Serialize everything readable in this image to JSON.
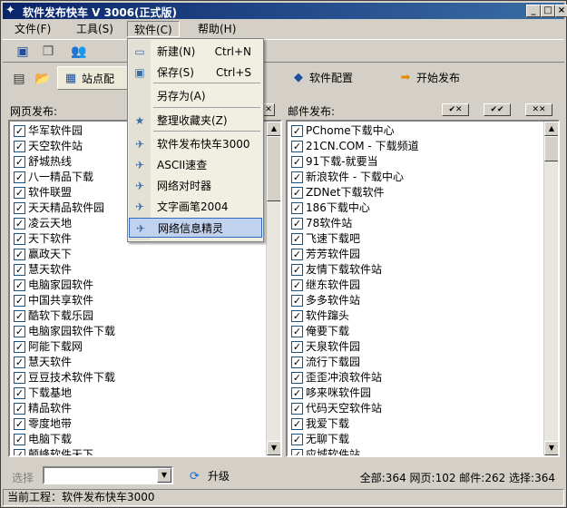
{
  "window": {
    "title": "软件发布快车 V 3006(正式版)",
    "controls": {
      "minimize": "_",
      "maximize": "□",
      "close": "×"
    }
  },
  "menubar": [
    "文件(F)",
    "工具(S)",
    "软件(C)",
    "帮助(H)"
  ],
  "toolbar2": {
    "site_config": "站点配",
    "software_config": "软件配置",
    "start_publish": "开始发布"
  },
  "left_panel": {
    "label": "网页发布:",
    "items": [
      "华军软件园",
      "天空软件站",
      "舒城热线",
      "八一精品下载",
      "软件联盟",
      "天天精品软件园",
      "凌云天地",
      "天下软件",
      "赢政天下",
      "慧天软件",
      "电脑家园软件",
      "中国共享软件",
      "酷软下载乐园",
      "电脑家园软件下载",
      "阿能下载网",
      "慧天软件",
      "豆豆技术软件下载",
      "下载基地",
      "精品软件",
      "零度地带",
      "电脑下载",
      "颠峰软件天下"
    ]
  },
  "right_panel": {
    "label": "邮件发布:",
    "buttons": [
      "✔✕",
      "✔✔",
      "✕✕"
    ],
    "items": [
      "PChome下载中心",
      "21CN.COM - 下载频道",
      "91下载-就要当",
      "新浪软件 - 下载中心",
      "ZDNet下载软件",
      "186下载中心",
      "78软件站",
      "飞速下载吧",
      "芳芳软件园",
      "友情下载软件站",
      "继东软件园",
      "多多软件站",
      "软件蹿头",
      "俺要下载",
      "天泉软件园",
      "流行下载园",
      "歪歪冲浪软件站",
      "哆来咪软件园",
      "代码天空软件站",
      "我爱下载",
      "无聊下载",
      "应城软件站"
    ]
  },
  "bottom": {
    "select_label": "选择",
    "upgrade": "升级",
    "stats": "全部:364 网页:102 邮件:262 选择:364"
  },
  "statusbar": "当前工程：软件发布快车3000",
  "dropdown": {
    "items": [
      {
        "label": "新建(N)",
        "shortcut": "Ctrl+N",
        "icon": "new-file-icon"
      },
      {
        "label": "保存(S)",
        "shortcut": "Ctrl+S",
        "icon": "save-icon"
      },
      {
        "label": "另存为(A)",
        "shortcut": "",
        "icon": ""
      },
      {
        "label": "整理收藏夹(Z)",
        "shortcut": "",
        "icon": "favorites-icon"
      },
      {
        "label": "软件发布快车3000",
        "shortcut": "",
        "icon": "project-icon"
      },
      {
        "label": "ASCII速查",
        "shortcut": "",
        "icon": "project-icon"
      },
      {
        "label": "网络对时器",
        "shortcut": "",
        "icon": "project-icon"
      },
      {
        "label": "文字画笔2004",
        "shortcut": "",
        "icon": "project-icon"
      },
      {
        "label": "网络信息精灵",
        "shortcut": "",
        "icon": "project-icon"
      }
    ]
  }
}
